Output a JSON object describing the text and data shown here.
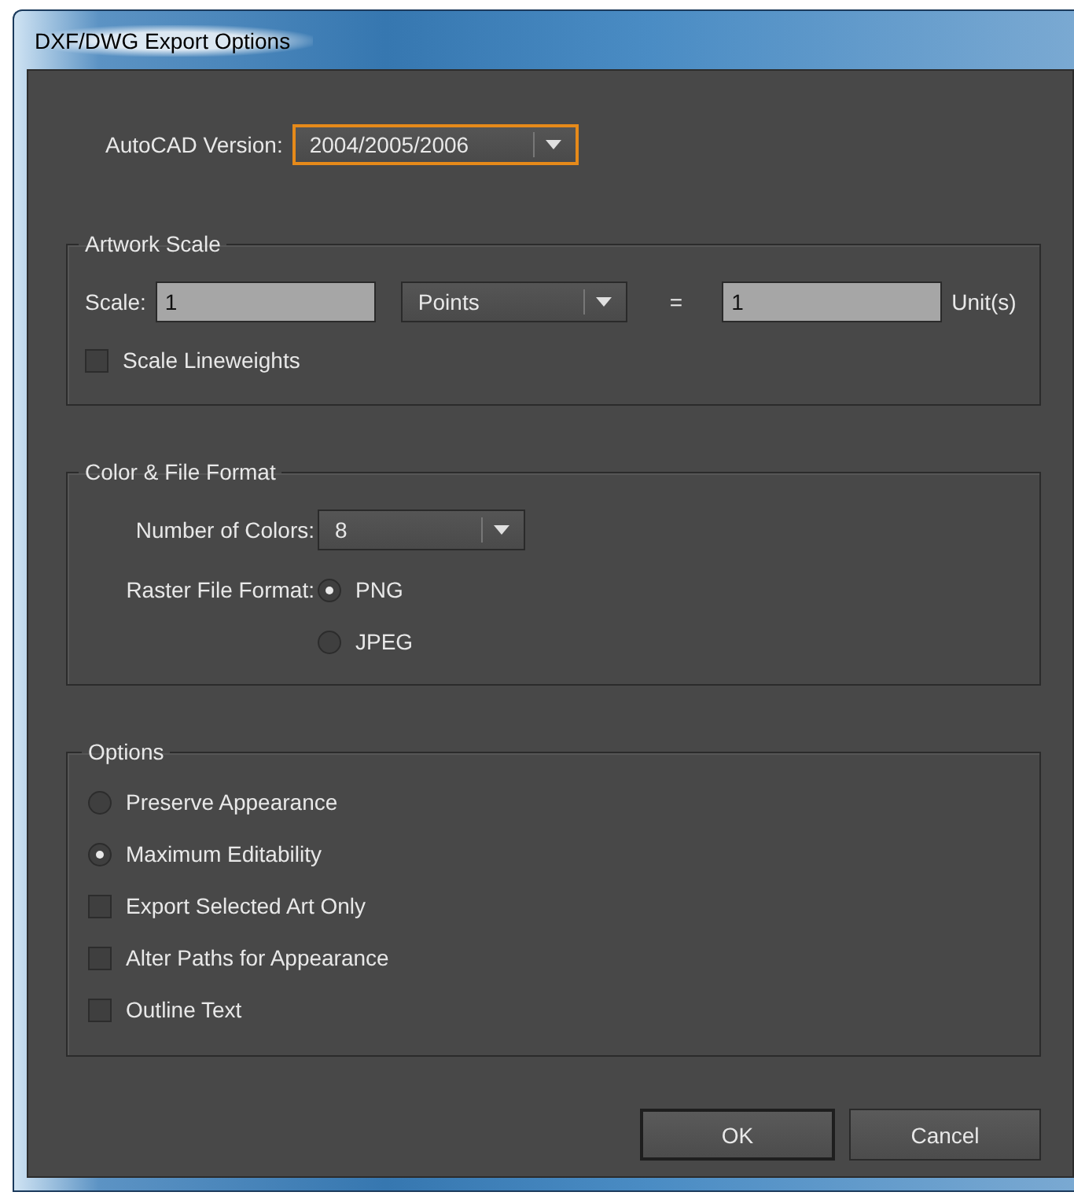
{
  "window": {
    "title": "DXF/DWG Export Options"
  },
  "autocad_version": {
    "label": "AutoCAD Version:",
    "value": "2004/2005/2006",
    "focused": true
  },
  "artwork_scale": {
    "title": "Artwork Scale",
    "scale_label": "Scale:",
    "scale_value": "1",
    "unit": "Points",
    "equals": "=",
    "units_value": "1",
    "units_label": "Unit(s)",
    "scale_lineweights": {
      "label": "Scale Lineweights",
      "checked": false
    }
  },
  "color_file_format": {
    "title": "Color & File Format",
    "colors_label": "Number of Colors:",
    "colors_value": "8",
    "raster_label": "Raster File Format:",
    "raster_formats": [
      {
        "label": "PNG",
        "selected": true
      },
      {
        "label": "JPEG",
        "selected": false
      }
    ]
  },
  "options": {
    "title": "Options",
    "items": [
      {
        "kind": "radio",
        "label": "Preserve Appearance",
        "selected": false
      },
      {
        "kind": "radio",
        "label": "Maximum Editability",
        "selected": true
      },
      {
        "kind": "checkbox",
        "label": "Export Selected Art Only",
        "checked": false
      },
      {
        "kind": "checkbox",
        "label": "Alter Paths for Appearance",
        "checked": false
      },
      {
        "kind": "checkbox",
        "label": "Outline Text",
        "checked": false
      }
    ]
  },
  "buttons": [
    {
      "label": "OK",
      "default": true
    },
    {
      "label": "Cancel",
      "default": false
    }
  ]
}
